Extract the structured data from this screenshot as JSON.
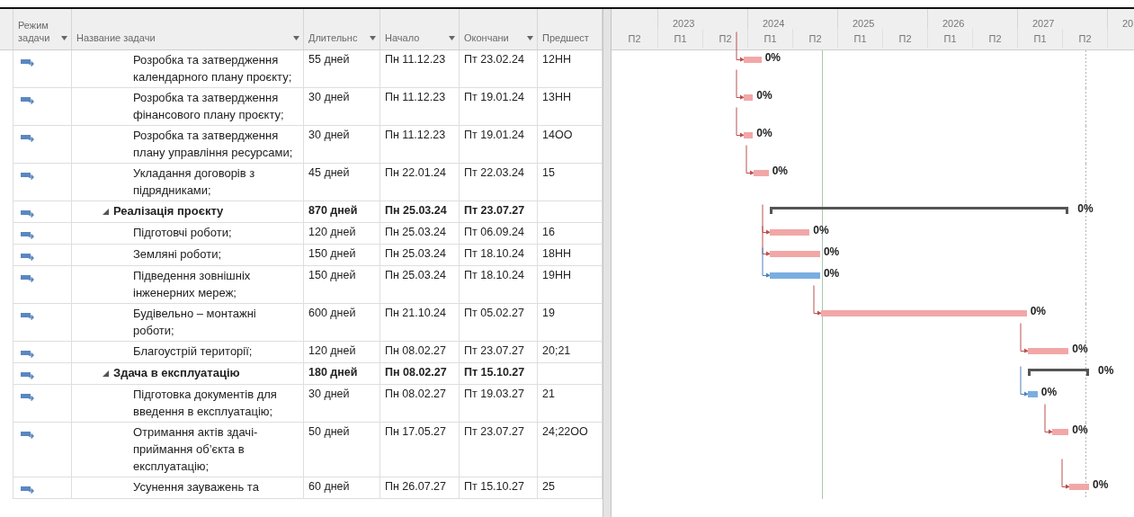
{
  "columns": [
    {
      "label": "Режим задачи",
      "menu": true
    },
    {
      "label": "Название задачи",
      "menu": true
    },
    {
      "label": "Длительнс",
      "menu": true
    },
    {
      "label": "Начало",
      "menu": true
    },
    {
      "label": "Окончани",
      "menu": true
    },
    {
      "label": "Предшест",
      "menu": false
    }
  ],
  "timescale": {
    "years": [
      "2023",
      "2024",
      "2025",
      "2026",
      "2027",
      "20"
    ],
    "halves": [
      "П2",
      "П1",
      "П2",
      "П1",
      "П2",
      "П1",
      "П2",
      "П1",
      "П2",
      "П1",
      "П2"
    ]
  },
  "tasks": [
    {
      "kind": "task",
      "name": "Розробка та затвердження календарного плану проєкту;",
      "duration": "55 дней",
      "start": "Пн 11.12.23",
      "finish": "Пт 23.02.24",
      "predecessors": "12НН",
      "critical": true,
      "linked": true,
      "progress": "0%"
    },
    {
      "kind": "task",
      "name": "Розробка та затвердження фінансового плану проєкту;",
      "duration": "30 дней",
      "start": "Пн 11.12.23",
      "finish": "Пт 19.01.24",
      "predecessors": "13НН",
      "critical": true,
      "linked": true,
      "progress": "0%"
    },
    {
      "kind": "task",
      "name": "Розробка та затвердження плану управління ресурсами;",
      "duration": "30 дней",
      "start": "Пн 11.12.23",
      "finish": "Пт 19.01.24",
      "predecessors": "14ОО",
      "critical": true,
      "linked": true,
      "progress": "0%"
    },
    {
      "kind": "task",
      "name": "Укладання договорів з підрядниками;",
      "duration": "45 дней",
      "start": "Пн 22.01.24",
      "finish": "Пт 22.03.24",
      "predecessors": "15",
      "critical": true,
      "linked": true,
      "progress": "0%"
    },
    {
      "kind": "summary",
      "expanded": true,
      "name": "Реалізація проєкту",
      "duration": "870 дней",
      "start": "Пн 25.03.24",
      "finish": "Пт 23.07.27",
      "progress": "0%"
    },
    {
      "kind": "task",
      "name": "Підготовчі роботи;",
      "duration": "120 дней",
      "start": "Пн 25.03.24",
      "finish": "Пт 06.09.24",
      "predecessors": "16",
      "critical": true,
      "linked": true,
      "progress": "0%"
    },
    {
      "kind": "task",
      "name": "Земляні роботи;",
      "duration": "150 дней",
      "start": "Пн 25.03.24",
      "finish": "Пт 18.10.24",
      "predecessors": "18НН",
      "critical": true,
      "linked": true,
      "progress": "0%"
    },
    {
      "kind": "task",
      "name": "Підведення зовнішніх інженерних мереж;",
      "duration": "150 дней",
      "start": "Пн 25.03.24",
      "finish": "Пт 18.10.24",
      "predecessors": "19НН",
      "critical": false,
      "linked": true,
      "progress": "0%"
    },
    {
      "kind": "task",
      "name": "Будівельно – монтажні роботи;",
      "duration": "600 дней",
      "start": "Пн 21.10.24",
      "finish": "Пт 05.02.27",
      "predecessors": "19",
      "critical": true,
      "linked": true,
      "progress": "0%"
    },
    {
      "kind": "task",
      "name": "Благоустрій території;",
      "duration": "120 дней",
      "start": "Пн 08.02.27",
      "finish": "Пт 23.07.27",
      "predecessors": "20;21",
      "critical": true,
      "linked": true,
      "progress": "0%"
    },
    {
      "kind": "summary",
      "expanded": true,
      "name": "Здача в експлуатацію",
      "duration": "180 дней",
      "start": "Пн 08.02.27",
      "finish": "Пт 15.10.27",
      "progress": "0%"
    },
    {
      "kind": "task",
      "name": "Підготовка документів для введення в експлуатацію;",
      "duration": "30 дней",
      "start": "Пн 08.02.27",
      "finish": "Пт 19.03.27",
      "predecessors": "21",
      "critical": false,
      "linked": true,
      "progress": "0%"
    },
    {
      "kind": "task",
      "name": "Отримання актів здачі-приймання об’єкта в експлуатацію;",
      "duration": "50 дней",
      "start": "Пн 17.05.27",
      "finish": "Пт 23.07.27",
      "predecessors": "24;22ОО",
      "critical": true,
      "linked": true,
      "progress": "0%"
    },
    {
      "kind": "task",
      "name": "Усунення зауважень та",
      "duration": "60 дней",
      "start": "Пн 26.07.27",
      "finish": "Пт 15.10.27",
      "predecessors": "25",
      "critical": true,
      "linked": true,
      "progress": "0%"
    }
  ]
}
